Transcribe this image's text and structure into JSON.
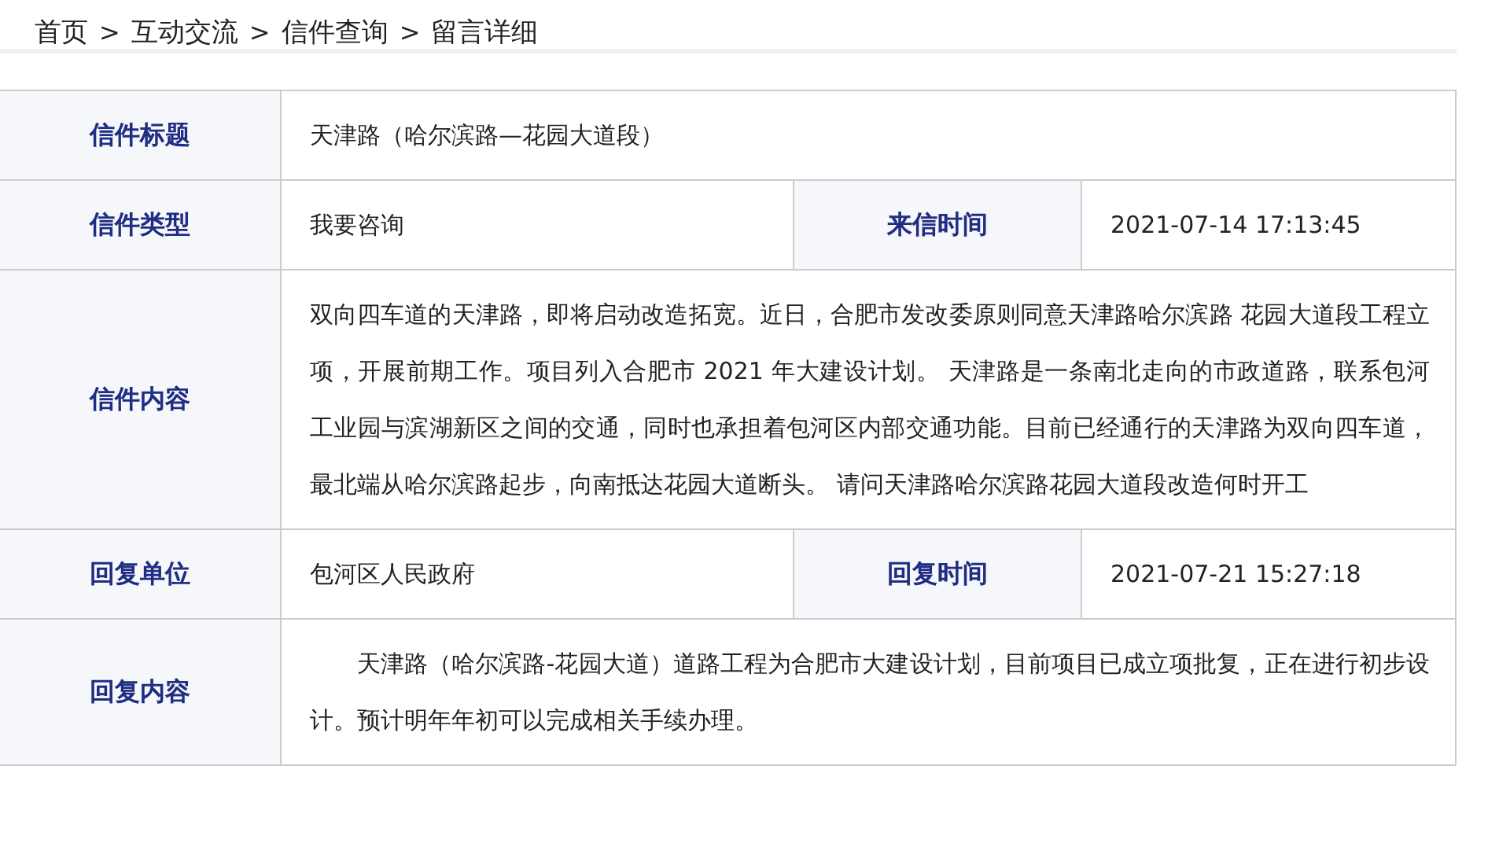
{
  "breadcrumb": {
    "separator": ">",
    "items": [
      "首页",
      "互动交流",
      "信件查询",
      "留言详细"
    ]
  },
  "rows": [
    {
      "kind": "single",
      "label": "信件标题",
      "value": "天津路（哈尔滨路—花园大道段）",
      "indent": false
    },
    {
      "kind": "pair",
      "label": "信件类型",
      "value": "我要咨询",
      "label_2": "来信时间",
      "value_2": "2021-07-14 17:13:45"
    },
    {
      "kind": "single",
      "label": "信件内容",
      "value": "双向四车道的天津路，即将启动改造拓宽。近日，合肥市发改委原则同意天津路哈尔滨路 花园大道段工程立项，开展前期工作。项目列入合肥市 2021 年大建设计划。 天津路是一条南北走向的市政道路，联系包河工业园与滨湖新区之间的交通，同时也承担着包河区内部交通功能。目前已经通行的天津路为双向四车道，最北端从哈尔滨路起步，向南抵达花园大道断头。 请问天津路哈尔滨路花园大道段改造何时开工",
      "indent": false
    },
    {
      "kind": "pair",
      "label": "回复单位",
      "value": "包河区人民政府",
      "label_2": "回复时间",
      "value_2": "2021-07-21 15:27:18"
    },
    {
      "kind": "single",
      "label": "回复内容",
      "value": "天津路（哈尔滨路-花园大道）道路工程为合肥市大建设计划，目前项目已成立项批复，正在进行初步设计。预计明年年初可以完成相关手续办理。",
      "indent": true
    }
  ]
}
